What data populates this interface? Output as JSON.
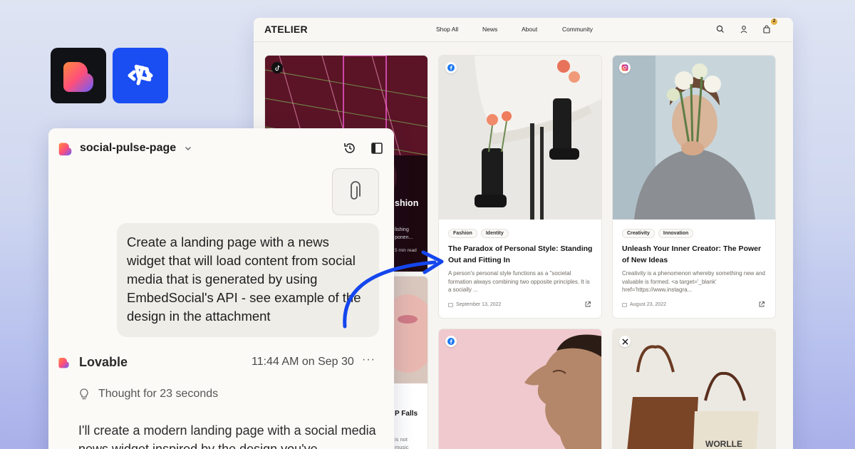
{
  "site": {
    "brand": "ATELIER",
    "nav": [
      "Shop All",
      "News",
      "About",
      "Community"
    ],
    "cart_count": "2",
    "cards": [
      {
        "platform": "tiktok",
        "partial_title": "shion",
        "partial_excerpt": [
          "lishing",
          "ponen..."
        ],
        "partial_meta": "5 min read"
      },
      {
        "platform": "facebook",
        "tags": [
          "Fashion",
          "Identity"
        ],
        "title": "The Paradox of Personal Style: Standing Out and Fitting In",
        "excerpt": "A person's personal style functions as a \"societal formation always combining two opposite principles. It is a socially ...",
        "date": "September 13, 2022"
      },
      {
        "platform": "instagram",
        "tags": [
          "Creativity",
          "Innovation"
        ],
        "title": "Unleash Your Inner Creator: The Power of New Ideas",
        "excerpt": "Creativity is a phenomenon whereby something new and valuable is formed. <a target='_blank' href='https://www.instagra...",
        "date": "August 23, 2022"
      },
      {
        "platform": "generic",
        "partial_title": "P Falls",
        "partial_excerpt": [
          "is not",
          "music"
        ]
      },
      {
        "platform": "facebook"
      },
      {
        "platform": "x"
      }
    ],
    "colors": {
      "facebook": "#1877f2",
      "accent_blue": "#1446ee"
    }
  },
  "chat": {
    "project_name": "social-pulse-page",
    "user_message": "Create a landing page with a news widget that will load content from social media that is generated by using EmbedSocial's API - see example of the design in the attachment",
    "assistant_name": "Lovable",
    "timestamp": "11:44 AM on Sep 30",
    "more": "···",
    "thought": "Thought for 23 seconds",
    "response": "I'll create a modern landing page with a social media news widget inspired by the design you've"
  },
  "icons": {
    "lovable_logo": "heart-gradient",
    "embedsocial_logo": "embedsocial-mark",
    "history": "history-icon",
    "sidebar": "sidebar-toggle-icon",
    "attachment": "paperclip-icon",
    "bulb": "lightbulb-icon"
  }
}
